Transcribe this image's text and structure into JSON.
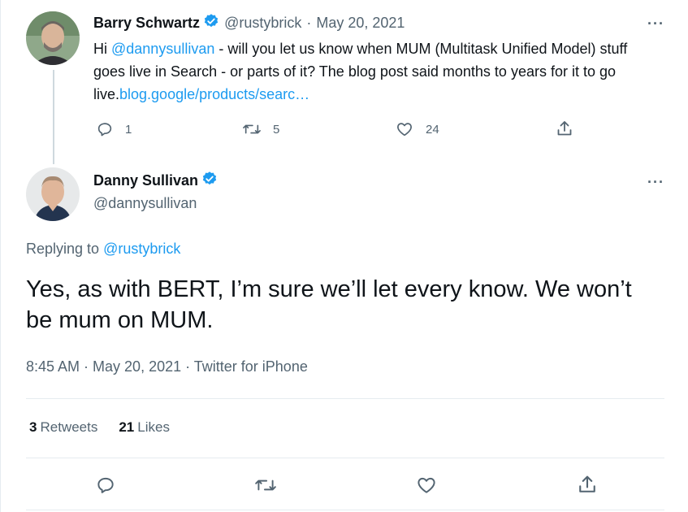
{
  "parent_tweet": {
    "author_name": "Barry Schwartz",
    "handle": "@rustybrick",
    "separator": "·",
    "date": "May 20, 2021",
    "more": "···",
    "text_pre": "Hi ",
    "mention": "@dannysullivan",
    "text_body": " - will you let us know when MUM (Multitask Unified Model) stuff goes live in Search - or parts of it? The blog post said months to years for it to go live.",
    "link": "blog.google/products/searc…",
    "reply_count": "1",
    "retweet_count": "5",
    "like_count": "24"
  },
  "main_tweet": {
    "author_name": "Danny Sullivan",
    "handle": "@dannysullivan",
    "more": "···",
    "replying_label": "Replying to ",
    "replying_handle": "@rustybrick",
    "text": "Yes, as with BERT, I’m sure we’ll let every know. We won’t be mum on MUM.",
    "meta": "8:45 AM · May 20, 2021 · Twitter for iPhone",
    "retweets_count": "3",
    "retweets_label": "Retweets",
    "likes_count": "21",
    "likes_label": "Likes"
  },
  "icons": {
    "reply": "reply-icon",
    "retweet": "retweet-icon",
    "like": "heart-icon",
    "share": "share-icon",
    "verified": "verified-badge-icon"
  },
  "colors": {
    "link": "#1d9bf0",
    "secondary_text": "#536471",
    "primary_text": "#0f1419",
    "verified": "#1d9bf0",
    "divider": "#e6ecf0"
  }
}
